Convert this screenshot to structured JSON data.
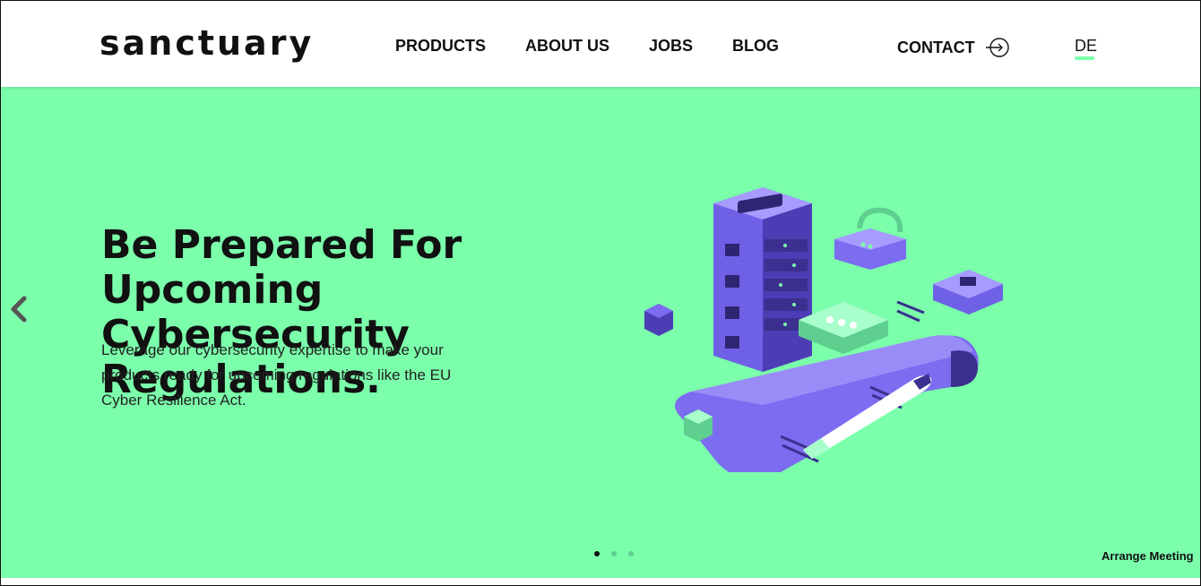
{
  "header": {
    "logo": "sanctuary",
    "nav": [
      "PRODUCTS",
      "ABOUT US",
      "JOBS",
      "BLOG"
    ],
    "contact_label": "CONTACT",
    "contact_icon": "arrow-circle-right-icon",
    "language": "DE"
  },
  "hero": {
    "title_line1": "Be Prepared For Upcoming",
    "title_line2": "Cybersecurity Regulations.",
    "subtitle": "Leverage our cybersecurity expertise to make your products ready for upcoming regulations like the EU Cyber Resilience Act.",
    "prev_icon": "chevron-left-icon",
    "arrange_meeting": "Arrange Meeting",
    "slides": {
      "count": 3,
      "active": 0
    }
  },
  "colors": {
    "accent": "#7bffab",
    "illustration_primary": "#7b6cf0",
    "illustration_dark": "#3b2f8f"
  }
}
